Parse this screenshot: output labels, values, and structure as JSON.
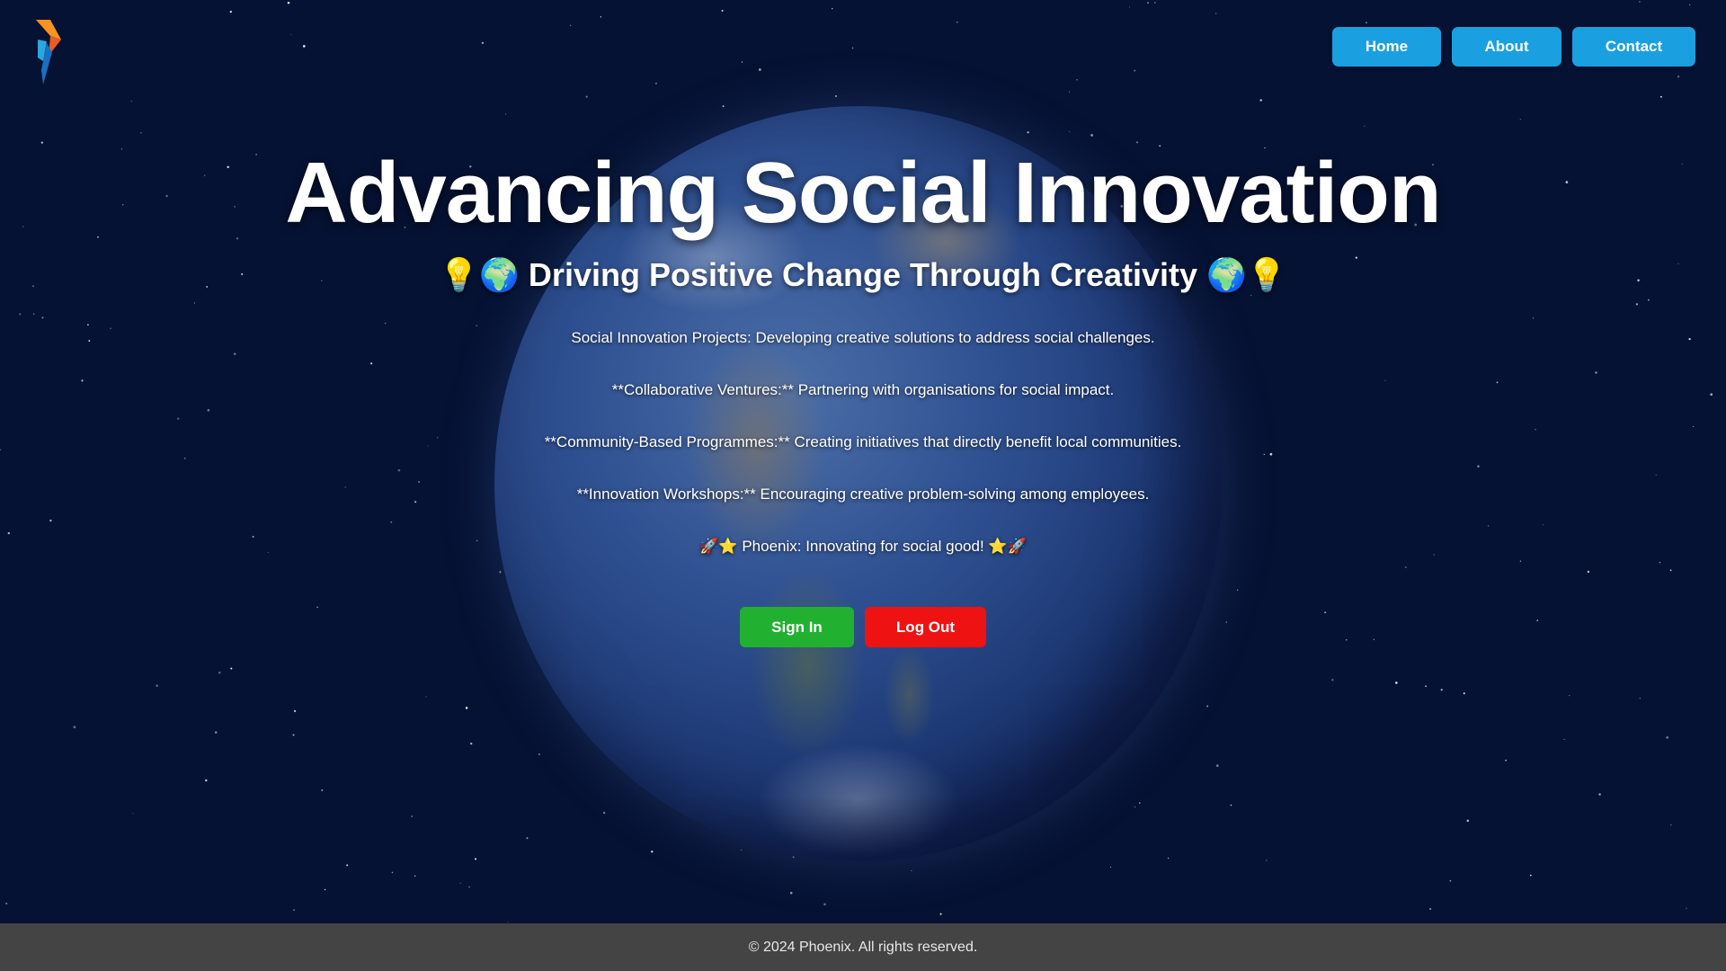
{
  "brand": {
    "logo_icon": "phoenix-logo-icon",
    "colors": {
      "orange": "#f7931e",
      "blue": "#29a8e0"
    }
  },
  "nav": {
    "items": [
      {
        "label": "Home"
      },
      {
        "label": "About"
      },
      {
        "label": "Contact"
      }
    ]
  },
  "hero": {
    "title": "Advancing Social Innovation",
    "subtitle": "💡🌍 Driving Positive Change Through Creativity 🌍💡",
    "paragraphs": [
      "Social Innovation Projects: Developing creative solutions to address social challenges.",
      "**Collaborative Ventures:** Partnering with organisations for social impact.",
      "**Community-Based Programmes:** Creating initiatives that directly benefit local communities.",
      "**Innovation Workshops:** Encouraging creative problem-solving among employees.",
      "🚀⭐ Phoenix: Innovating for social good! ⭐🚀"
    ]
  },
  "actions": {
    "sign_in": "Sign In",
    "log_out": "Log Out"
  },
  "footer": {
    "text": "© 2024 Phoenix. All rights reserved."
  },
  "theme": {
    "background": "#061233",
    "nav_button": "#1aa0e0",
    "sign_in": "#22b030",
    "log_out": "#ef1212",
    "footer_bg": "#444444"
  }
}
